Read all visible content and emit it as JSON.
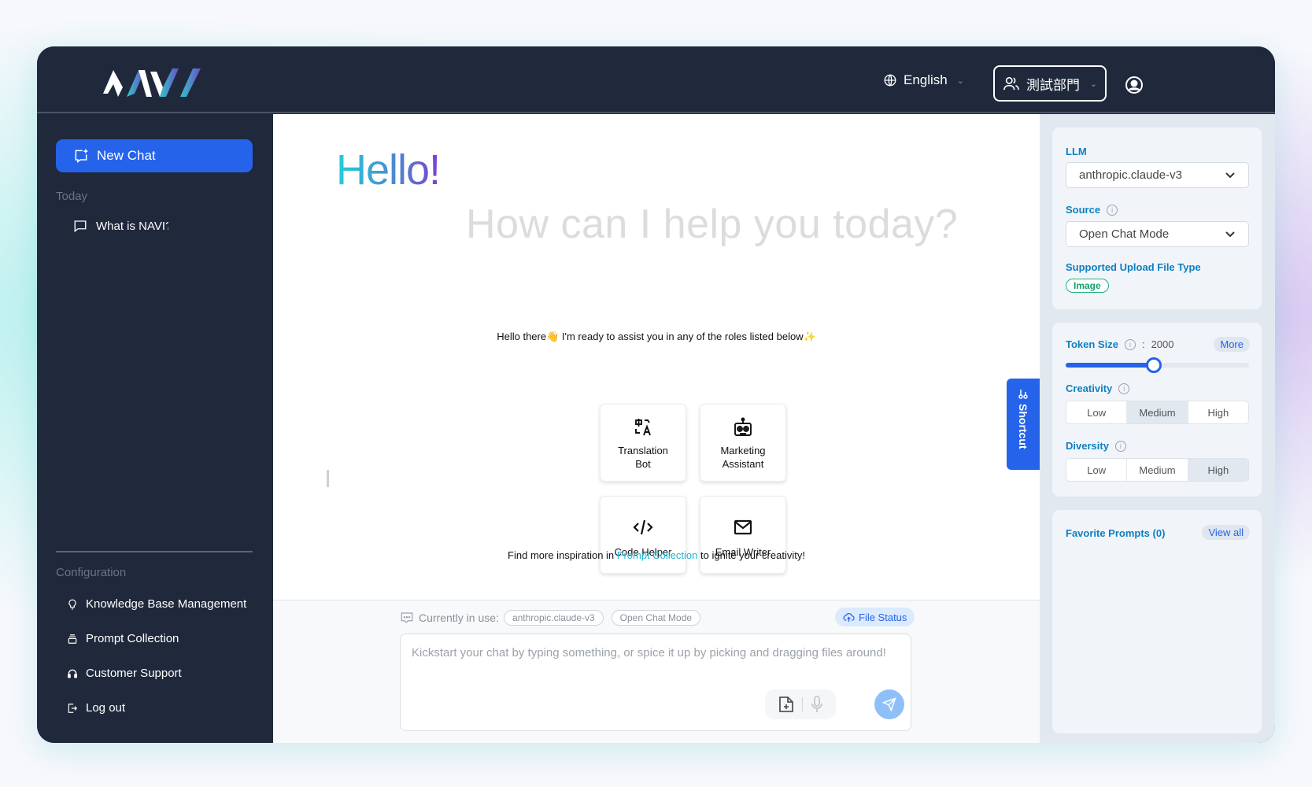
{
  "header": {
    "logo_text": "NAVI",
    "language": "English",
    "department": "測試部門"
  },
  "sidebar": {
    "new_chat_label": "New Chat",
    "history_group": "Today",
    "history": [
      {
        "title": "What is NAVI?"
      }
    ],
    "config_group": "Configuration",
    "config_items": [
      {
        "label": "Knowledge Base Management",
        "icon": "lightbulb-icon"
      },
      {
        "label": "Prompt Collection",
        "icon": "prompt-collection-icon"
      },
      {
        "label": "Customer Support",
        "icon": "headset-icon"
      },
      {
        "label": "Log out",
        "icon": "logout-icon"
      }
    ]
  },
  "main": {
    "greeting": "Hello!",
    "subtitle": "How can I help you today?",
    "roles_intro_before": "Hello there",
    "roles_intro_emoji": "👋",
    "roles_intro_after": " I'm ready to assist you in any of the roles listed below",
    "roles_intro_sparkle": "✨",
    "roles": [
      {
        "line1": "Translation",
        "line2": "Bot",
        "icon": "translate-icon"
      },
      {
        "line1": "Marketing",
        "line2": "Assistant",
        "icon": "robot-icon"
      },
      {
        "line1": "Code Helper",
        "line2": "",
        "icon": "code-icon"
      },
      {
        "line1": "Email Writer",
        "line2": "",
        "icon": "mail-icon"
      }
    ],
    "inspire_before": "Find more inspiration in ",
    "inspire_link": "Prompt Collection",
    "inspire_after": " to ignite your creativity!"
  },
  "input": {
    "in_use_label": "Currently in use:",
    "model_pill": "anthropic.claude-v3",
    "mode_pill": "Open Chat Mode",
    "file_status": "File Status",
    "placeholder": "Kickstart your chat by typing something, or spice it up by picking and dragging files around!"
  },
  "shortcut_label": "Shortcut",
  "settings": {
    "llm_label": "LLM",
    "llm_value": "anthropic.claude-v3",
    "source_label": "Source",
    "source_value": "Open Chat Mode",
    "upload_label": "Supported Upload File Type",
    "upload_types": [
      "Image"
    ],
    "token_label": "Token Size",
    "token_value": "2000",
    "token_fraction": 0.48,
    "more_label": "More",
    "creativity_label": "Creativity",
    "creativity_options": [
      "Low",
      "Medium",
      "High"
    ],
    "creativity_selected": "Medium",
    "diversity_label": "Diversity",
    "diversity_options": [
      "Low",
      "Medium",
      "High"
    ],
    "diversity_selected": "High",
    "favorites_label": "Favorite Prompts (0)",
    "view_all_label": "View all"
  },
  "colors": {
    "primary": "#2563eb",
    "sidebar_bg": "#1f293b",
    "label_blue": "#0e7fc0",
    "badge_green": "#22b07d"
  }
}
